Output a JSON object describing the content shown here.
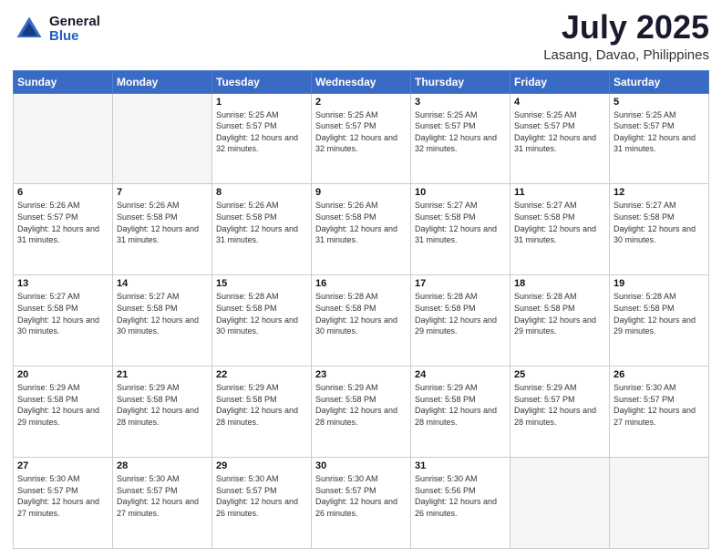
{
  "header": {
    "logo_general": "General",
    "logo_blue": "Blue",
    "title": "July 2025",
    "subtitle": "Lasang, Davao, Philippines"
  },
  "calendar": {
    "days_of_week": [
      "Sunday",
      "Monday",
      "Tuesday",
      "Wednesday",
      "Thursday",
      "Friday",
      "Saturday"
    ],
    "weeks": [
      {
        "cells": [
          {
            "day": "",
            "empty": true
          },
          {
            "day": "",
            "empty": true
          },
          {
            "day": "1",
            "sunrise": "5:25 AM",
            "sunset": "5:57 PM",
            "daylight": "12 hours and 32 minutes."
          },
          {
            "day": "2",
            "sunrise": "5:25 AM",
            "sunset": "5:57 PM",
            "daylight": "12 hours and 32 minutes."
          },
          {
            "day": "3",
            "sunrise": "5:25 AM",
            "sunset": "5:57 PM",
            "daylight": "12 hours and 32 minutes."
          },
          {
            "day": "4",
            "sunrise": "5:25 AM",
            "sunset": "5:57 PM",
            "daylight": "12 hours and 31 minutes."
          },
          {
            "day": "5",
            "sunrise": "5:25 AM",
            "sunset": "5:57 PM",
            "daylight": "12 hours and 31 minutes."
          }
        ]
      },
      {
        "cells": [
          {
            "day": "6",
            "sunrise": "5:26 AM",
            "sunset": "5:57 PM",
            "daylight": "12 hours and 31 minutes."
          },
          {
            "day": "7",
            "sunrise": "5:26 AM",
            "sunset": "5:58 PM",
            "daylight": "12 hours and 31 minutes."
          },
          {
            "day": "8",
            "sunrise": "5:26 AM",
            "sunset": "5:58 PM",
            "daylight": "12 hours and 31 minutes."
          },
          {
            "day": "9",
            "sunrise": "5:26 AM",
            "sunset": "5:58 PM",
            "daylight": "12 hours and 31 minutes."
          },
          {
            "day": "10",
            "sunrise": "5:27 AM",
            "sunset": "5:58 PM",
            "daylight": "12 hours and 31 minutes."
          },
          {
            "day": "11",
            "sunrise": "5:27 AM",
            "sunset": "5:58 PM",
            "daylight": "12 hours and 31 minutes."
          },
          {
            "day": "12",
            "sunrise": "5:27 AM",
            "sunset": "5:58 PM",
            "daylight": "12 hours and 30 minutes."
          }
        ]
      },
      {
        "cells": [
          {
            "day": "13",
            "sunrise": "5:27 AM",
            "sunset": "5:58 PM",
            "daylight": "12 hours and 30 minutes."
          },
          {
            "day": "14",
            "sunrise": "5:27 AM",
            "sunset": "5:58 PM",
            "daylight": "12 hours and 30 minutes."
          },
          {
            "day": "15",
            "sunrise": "5:28 AM",
            "sunset": "5:58 PM",
            "daylight": "12 hours and 30 minutes."
          },
          {
            "day": "16",
            "sunrise": "5:28 AM",
            "sunset": "5:58 PM",
            "daylight": "12 hours and 30 minutes."
          },
          {
            "day": "17",
            "sunrise": "5:28 AM",
            "sunset": "5:58 PM",
            "daylight": "12 hours and 29 minutes."
          },
          {
            "day": "18",
            "sunrise": "5:28 AM",
            "sunset": "5:58 PM",
            "daylight": "12 hours and 29 minutes."
          },
          {
            "day": "19",
            "sunrise": "5:28 AM",
            "sunset": "5:58 PM",
            "daylight": "12 hours and 29 minutes."
          }
        ]
      },
      {
        "cells": [
          {
            "day": "20",
            "sunrise": "5:29 AM",
            "sunset": "5:58 PM",
            "daylight": "12 hours and 29 minutes."
          },
          {
            "day": "21",
            "sunrise": "5:29 AM",
            "sunset": "5:58 PM",
            "daylight": "12 hours and 28 minutes."
          },
          {
            "day": "22",
            "sunrise": "5:29 AM",
            "sunset": "5:58 PM",
            "daylight": "12 hours and 28 minutes."
          },
          {
            "day": "23",
            "sunrise": "5:29 AM",
            "sunset": "5:58 PM",
            "daylight": "12 hours and 28 minutes."
          },
          {
            "day": "24",
            "sunrise": "5:29 AM",
            "sunset": "5:58 PM",
            "daylight": "12 hours and 28 minutes."
          },
          {
            "day": "25",
            "sunrise": "5:29 AM",
            "sunset": "5:57 PM",
            "daylight": "12 hours and 28 minutes."
          },
          {
            "day": "26",
            "sunrise": "5:30 AM",
            "sunset": "5:57 PM",
            "daylight": "12 hours and 27 minutes."
          }
        ]
      },
      {
        "cells": [
          {
            "day": "27",
            "sunrise": "5:30 AM",
            "sunset": "5:57 PM",
            "daylight": "12 hours and 27 minutes."
          },
          {
            "day": "28",
            "sunrise": "5:30 AM",
            "sunset": "5:57 PM",
            "daylight": "12 hours and 27 minutes."
          },
          {
            "day": "29",
            "sunrise": "5:30 AM",
            "sunset": "5:57 PM",
            "daylight": "12 hours and 26 minutes."
          },
          {
            "day": "30",
            "sunrise": "5:30 AM",
            "sunset": "5:57 PM",
            "daylight": "12 hours and 26 minutes."
          },
          {
            "day": "31",
            "sunrise": "5:30 AM",
            "sunset": "5:56 PM",
            "daylight": "12 hours and 26 minutes."
          },
          {
            "day": "",
            "empty": true
          },
          {
            "day": "",
            "empty": true
          }
        ]
      }
    ]
  }
}
